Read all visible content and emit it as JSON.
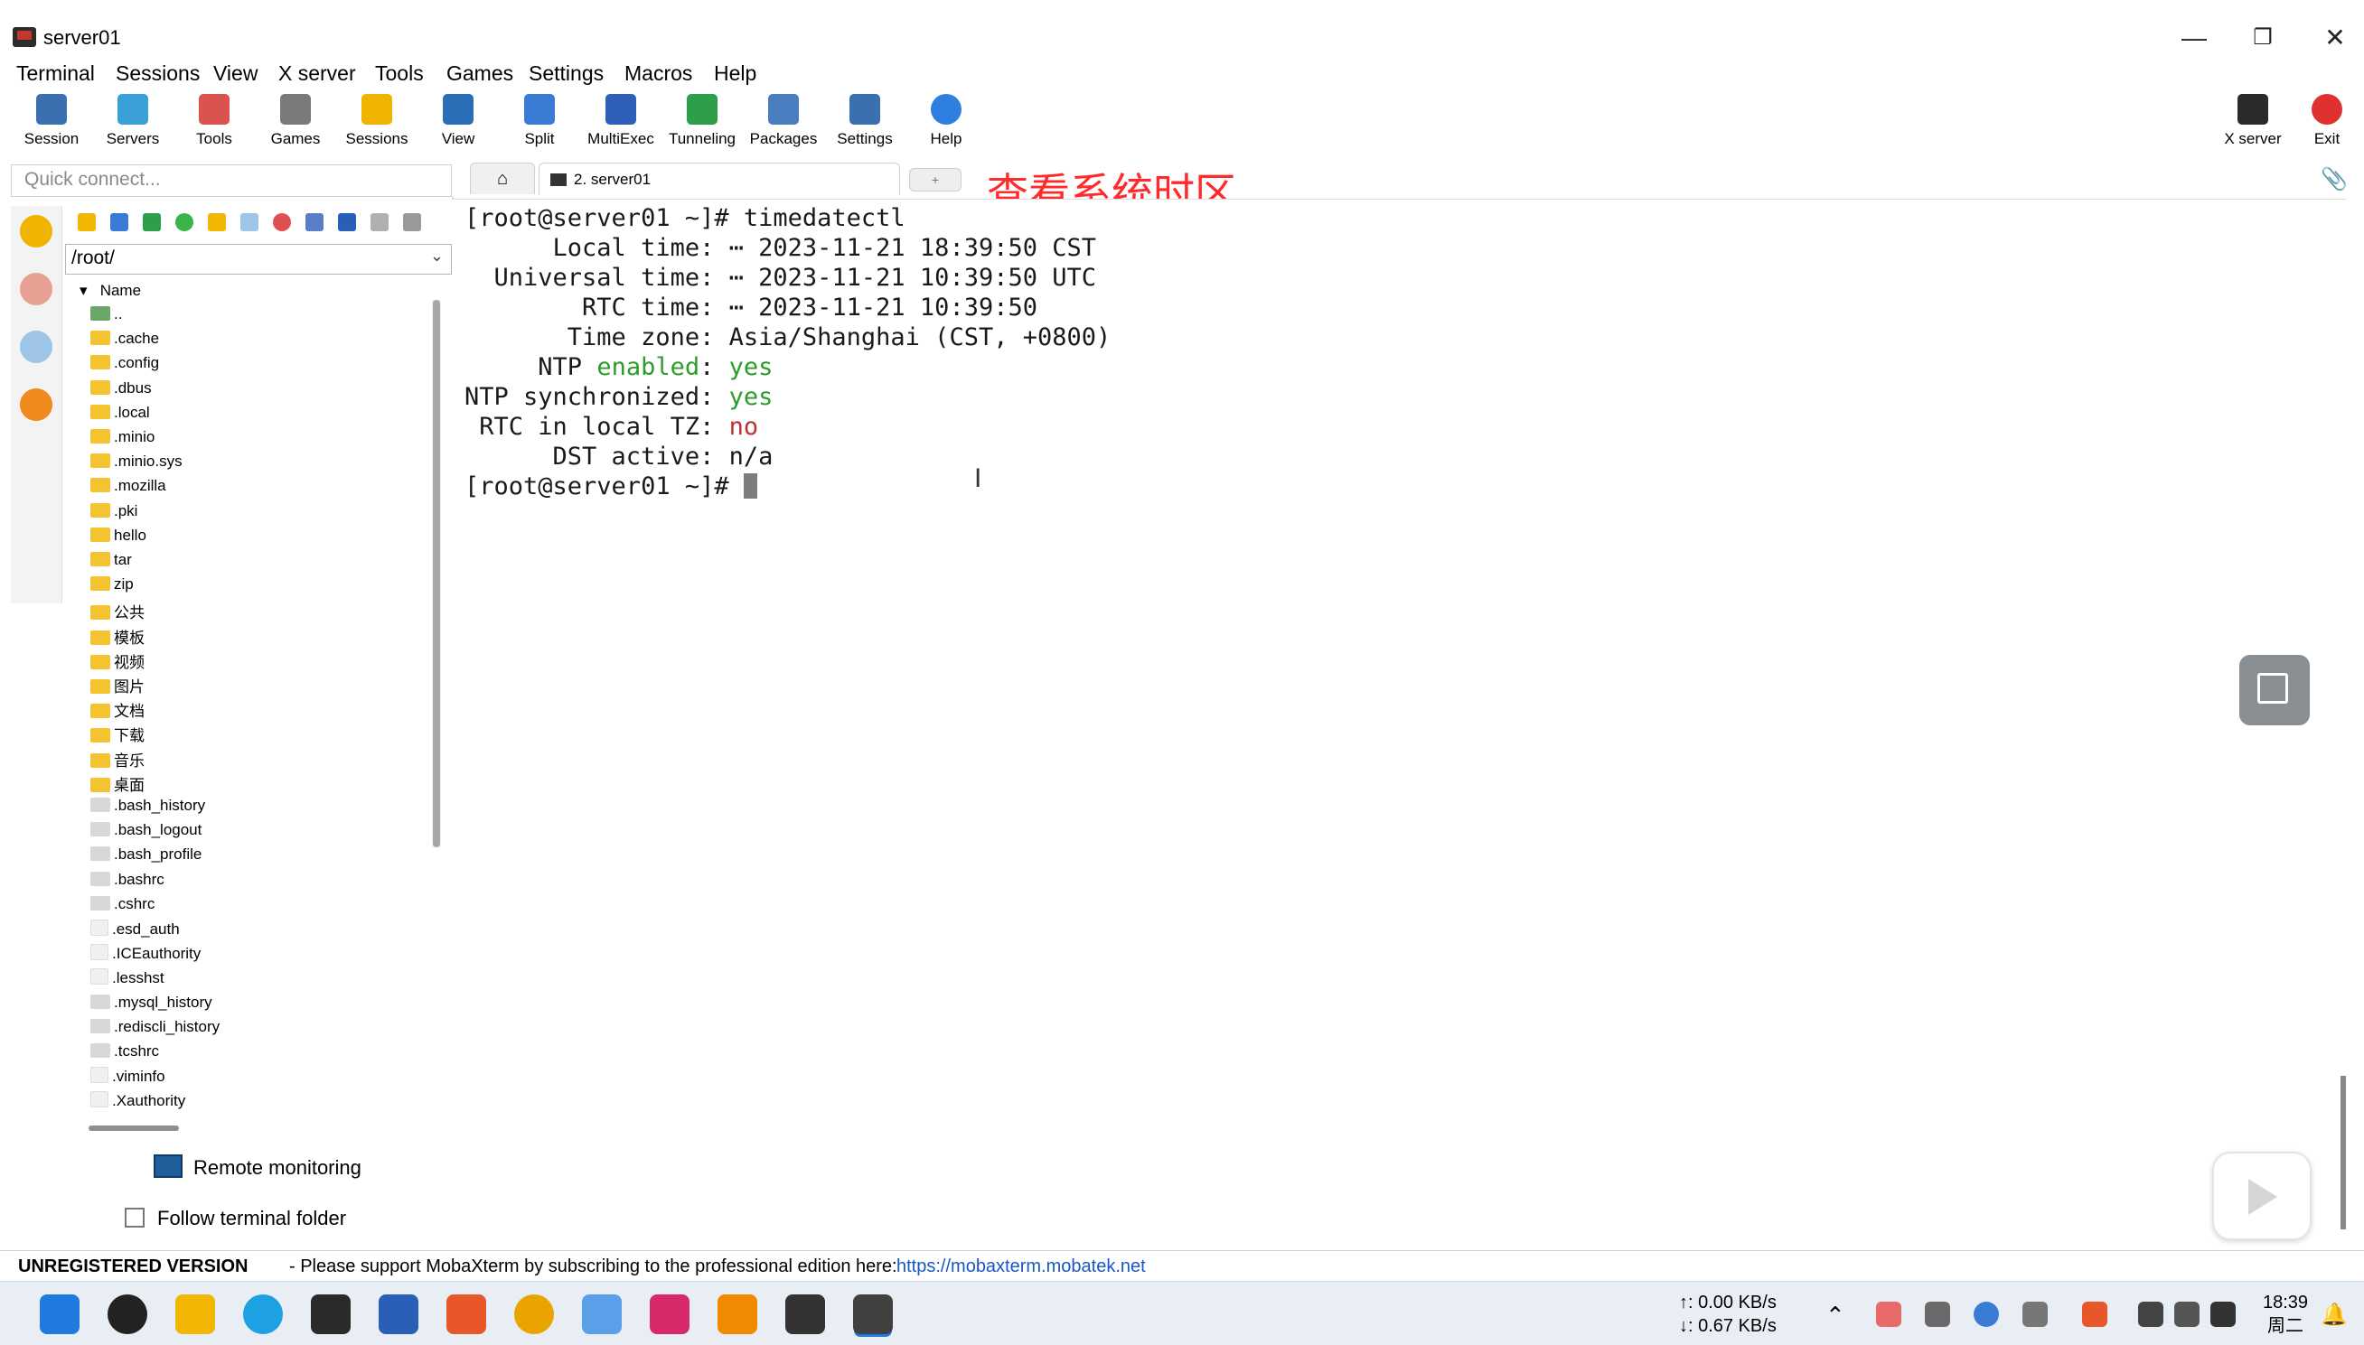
{
  "window": {
    "title": "server01",
    "minimize": "—",
    "restore": "❐",
    "close": "✕"
  },
  "menu": [
    "Terminal",
    "Sessions",
    "View",
    "X server",
    "Tools",
    "Games",
    "Settings",
    "Macros",
    "Help"
  ],
  "toolbar": {
    "items": [
      {
        "label": "Session",
        "color": "#3a6fb0"
      },
      {
        "label": "Servers",
        "color": "#3aa0d8"
      },
      {
        "label": "Tools",
        "color": "#d9534f"
      },
      {
        "label": "Games",
        "color": "#7a7a7a"
      },
      {
        "label": "Sessions",
        "color": "#f0b400"
      },
      {
        "label": "View",
        "color": "#2a6fb5"
      },
      {
        "label": "Split",
        "color": "#3a7bd5"
      },
      {
        "label": "MultiExec",
        "color": "#2f5fb8"
      },
      {
        "label": "Tunneling",
        "color": "#2e9e4a"
      },
      {
        "label": "Packages",
        "color": "#4a7ec0"
      },
      {
        "label": "Settings",
        "color": "#3a6fb0"
      },
      {
        "label": "Help",
        "color": "#2f7fe0"
      }
    ],
    "right": [
      {
        "label": "X server",
        "color": "#2a2a2a"
      },
      {
        "label": "Exit",
        "color": "#e03030"
      }
    ]
  },
  "sidebar": {
    "quick_connect_placeholder": "Quick connect...",
    "path": "/root/",
    "column_header": "Name",
    "files": [
      {
        "name": "..",
        "type": "up"
      },
      {
        "name": ".cache",
        "type": "folder"
      },
      {
        "name": ".config",
        "type": "folder"
      },
      {
        "name": ".dbus",
        "type": "folder"
      },
      {
        "name": ".local",
        "type": "folder"
      },
      {
        "name": ".minio",
        "type": "folder"
      },
      {
        "name": ".minio.sys",
        "type": "folder"
      },
      {
        "name": ".mozilla",
        "type": "folder"
      },
      {
        "name": ".pki",
        "type": "folder"
      },
      {
        "name": "hello",
        "type": "folder"
      },
      {
        "name": "tar",
        "type": "folder"
      },
      {
        "name": "zip",
        "type": "folder"
      },
      {
        "name": "公共",
        "type": "folder"
      },
      {
        "name": "模板",
        "type": "folder"
      },
      {
        "name": "视频",
        "type": "folder"
      },
      {
        "name": "图片",
        "type": "folder"
      },
      {
        "name": "文档",
        "type": "folder"
      },
      {
        "name": "下载",
        "type": "folder"
      },
      {
        "name": "音乐",
        "type": "folder"
      },
      {
        "name": "桌面",
        "type": "folder"
      },
      {
        "name": ".bash_history",
        "type": "file"
      },
      {
        "name": ".bash_logout",
        "type": "file"
      },
      {
        "name": ".bash_profile",
        "type": "file"
      },
      {
        "name": ".bashrc",
        "type": "file"
      },
      {
        "name": ".cshrc",
        "type": "file"
      },
      {
        "name": ".esd_auth",
        "type": "blank"
      },
      {
        "name": ".ICEauthority",
        "type": "blank"
      },
      {
        "name": ".lesshst",
        "type": "blank"
      },
      {
        "name": ".mysql_history",
        "type": "file"
      },
      {
        "name": ".rediscli_history",
        "type": "file"
      },
      {
        "name": ".tcshrc",
        "type": "file"
      },
      {
        "name": ".viminfo",
        "type": "blank"
      },
      {
        "name": ".Xauthority",
        "type": "blank"
      }
    ],
    "remote_monitoring": "Remote monitoring",
    "follow_terminal_folder": "Follow terminal folder"
  },
  "tabs": {
    "home_icon": "⌂",
    "session_tab": "2. server01",
    "new_tab": "+"
  },
  "annotation": "查看系统时区",
  "terminal": {
    "prompt1": "[root@server01 ~]# ",
    "command1": "timedatectl",
    "local_label": "      Local time: ",
    "local_value": "⋯ 2023-11-21 18:39:50 CST",
    "universal_label": "  Universal time: ",
    "universal_value": "⋯ 2023-11-21 10:39:50 UTC",
    "rtc_label": "        RTC time: ",
    "rtc_value": "⋯ 2023-11-21 10:39:50",
    "tz_label": "       Time zone: ",
    "tz_value": "Asia/Shanghai (CST, +0800)",
    "ntp_label_a": "     NTP ",
    "ntp_label_b": "enabled",
    "ntp_label_c": ": ",
    "ntp_value": "yes",
    "sync_label": "NTP synchronized: ",
    "sync_value": "yes",
    "rtc_local_label": " RTC in local TZ: ",
    "rtc_local_value": "no",
    "dst_label": "      DST active: ",
    "dst_value": "n/a",
    "prompt2": "[root@server01 ~]# "
  },
  "status": {
    "unregistered": "UNREGISTERED VERSION",
    "message": "-  Please support MobaXterm by subscribing to the professional edition here:",
    "link": "https://mobaxterm.mobatek.net"
  },
  "taskbar": {
    "apps": [
      {
        "name": "start",
        "color": "#1f7ae0"
      },
      {
        "name": "search",
        "color": "#222222"
      },
      {
        "name": "explorer",
        "color": "#f2b705"
      },
      {
        "name": "edge",
        "color": "#1da1e2"
      },
      {
        "name": "terminal",
        "color": "#2a2a2a"
      },
      {
        "name": "store",
        "color": "#2a5fb8"
      },
      {
        "name": "app-orange",
        "color": "#e8572a"
      },
      {
        "name": "chrome",
        "color": "#e9a400"
      },
      {
        "name": "app-colorful",
        "color": "#5aa0e8"
      },
      {
        "name": "intellij",
        "color": "#d62a6a"
      },
      {
        "name": "sublime",
        "color": "#f08a00"
      },
      {
        "name": "typora",
        "color": "#333333"
      },
      {
        "name": "mobaxterm",
        "color": "#404040"
      }
    ],
    "net_up": "↑: 0.00 KB/s",
    "net_down": "↓: 0.67 KB/s",
    "time": "18:39",
    "weekday": "周二"
  }
}
